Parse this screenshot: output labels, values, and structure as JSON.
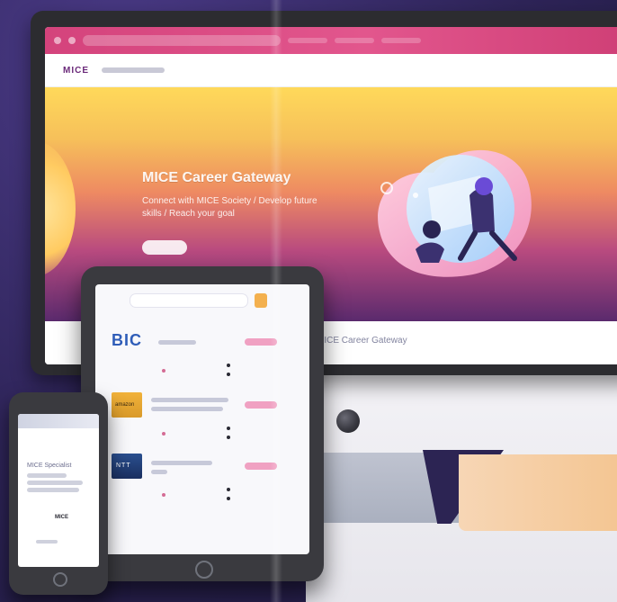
{
  "hero": {
    "title": "MICE Career Gateway",
    "subtitle": "Connect with MICE Society / Develop future skills / Reach your goal"
  },
  "section": {
    "text": "MICE Career Gateway"
  },
  "tablet": {
    "brands": {
      "bic": "BIC",
      "amazon": "amazon",
      "ntt": "NTT"
    }
  },
  "phone": {
    "title": "MICE Specialist",
    "mid": "MICE"
  },
  "colors": {
    "browser_pink": "#d4437c",
    "hero_yellow": "#ffd95a",
    "hero_purple": "#5a2a6d",
    "accent_orange": "#f3b04e",
    "bic_blue": "#2f5db8"
  }
}
